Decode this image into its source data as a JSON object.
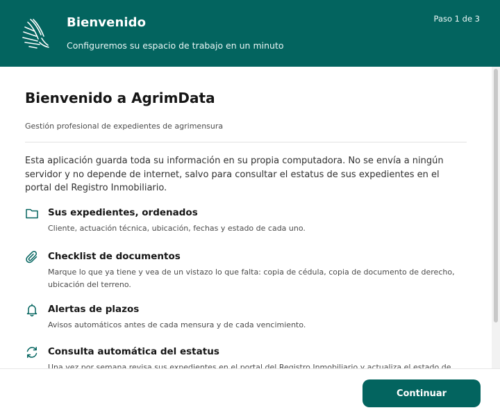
{
  "header": {
    "title": "Bienvenido",
    "subtitle": "Configuremos su espacio de trabajo en un minuto",
    "step": "Paso 1 de 3",
    "logo_icon": "plumb-bob-logo-icon"
  },
  "main": {
    "title": "Bienvenido a AgrimData",
    "subtitle": "Gestión profesional de expedientes de agrimensura",
    "intro": "Esta aplicación guarda toda su información en su propia computadora. No se envía a ningún servidor y no depende de internet, salvo para consultar el estatus de sus expedientes en el portal del Registro Inmobiliario."
  },
  "features": [
    {
      "icon": "folder-icon",
      "title": "Sus expedientes, ordenados",
      "description": "Cliente, actuación técnica, ubicación, fechas y estado de cada uno."
    },
    {
      "icon": "paperclip-icon",
      "title": "Checklist de documentos",
      "description": "Marque lo que ya tiene y vea de un vistazo lo que falta: copia de cédula, copia de documento de derecho, ubicación del terreno."
    },
    {
      "icon": "bell-icon",
      "title": "Alertas de plazos",
      "description": "Avisos automáticos antes de cada mensura y de cada vencimiento."
    },
    {
      "icon": "refresh-icon",
      "title": "Consulta automática del estatus",
      "description": "Una vez por semana revisa sus expedientes en el portal del Registro Inmobiliario y actualiza el estado de cada uno."
    }
  ],
  "footer": {
    "continue_label": "Continuar"
  },
  "colors": {
    "brand": "#03645f",
    "text": "#151515",
    "muted": "#4a4a4a"
  }
}
